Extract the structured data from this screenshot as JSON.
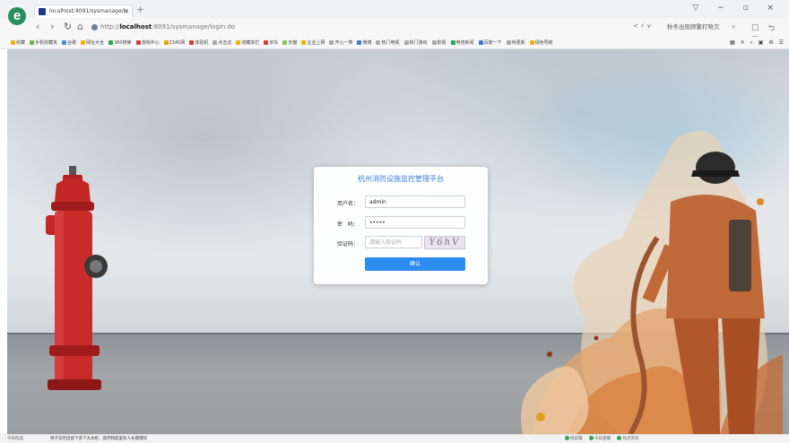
{
  "browser": {
    "tab_title": "localhost:8091/sysmanage/lo",
    "new_tab_symbol": "+",
    "url_prefix": "http://",
    "url_host": "localhost",
    "url_path": ":8091/sysmanage/login.do",
    "search_text": "秋冬出现频繁打哈欠",
    "window_controls": "▽ − ▫ ×"
  },
  "bookmarks": [
    {
      "label": "收藏",
      "color": "#f0b400"
    },
    {
      "label": "手机收藏夹",
      "color": "#7aa84f"
    },
    {
      "label": "谷歌",
      "color": "#4a90d9"
    },
    {
      "label": "网址大全",
      "color": "#f0b400"
    },
    {
      "label": "360搜索",
      "color": "#2aa35a"
    },
    {
      "label": "游戏中心",
      "color": "#d63b3b"
    },
    {
      "label": "2345网",
      "color": "#f0a000"
    },
    {
      "label": "体验机",
      "color": "#d63b3b"
    },
    {
      "label": "点击这",
      "color": "#aaaaaa"
    },
    {
      "label": "收藏夹栏",
      "color": "#f0b400"
    },
    {
      "label": "京东",
      "color": "#d63b3b"
    },
    {
      "label": "天猫",
      "color": "#8bc34a"
    },
    {
      "label": "企业上网",
      "color": "#f0b400"
    },
    {
      "label": "开心一笑",
      "color": "#aaaaaa"
    },
    {
      "label": "微博",
      "color": "#3a7bd5"
    },
    {
      "label": "热门电视",
      "color": "#aaaaaa"
    },
    {
      "label": "热门游戏",
      "color": "#aaaaaa"
    },
    {
      "label": "影视",
      "color": "#aaaaaa"
    },
    {
      "label": "电竞新闻",
      "color": "#2aa35a"
    },
    {
      "label": "百度一下",
      "color": "#3a7bd5"
    },
    {
      "label": "待更新",
      "color": "#aaaaaa"
    },
    {
      "label": "绿色导航",
      "color": "#f0b400"
    }
  ],
  "login": {
    "title": "杭州消防设施监控管理平台",
    "username_label": "用户名：",
    "username_value": "admin",
    "password_label": "密　码：",
    "password_value": "•••••",
    "captcha_label": "验证码：",
    "captcha_placeholder": "请输入验证码",
    "captcha_text": "Y6hV",
    "submit_label": "确认"
  },
  "statusbar": {
    "left": "今日优选",
    "news": "男子去世后留下多个大冰柜，竟然和屋里有人长期潜伏",
    "right_items": [
      "快剪辑",
      "今日直播",
      "热点资讯"
    ]
  }
}
